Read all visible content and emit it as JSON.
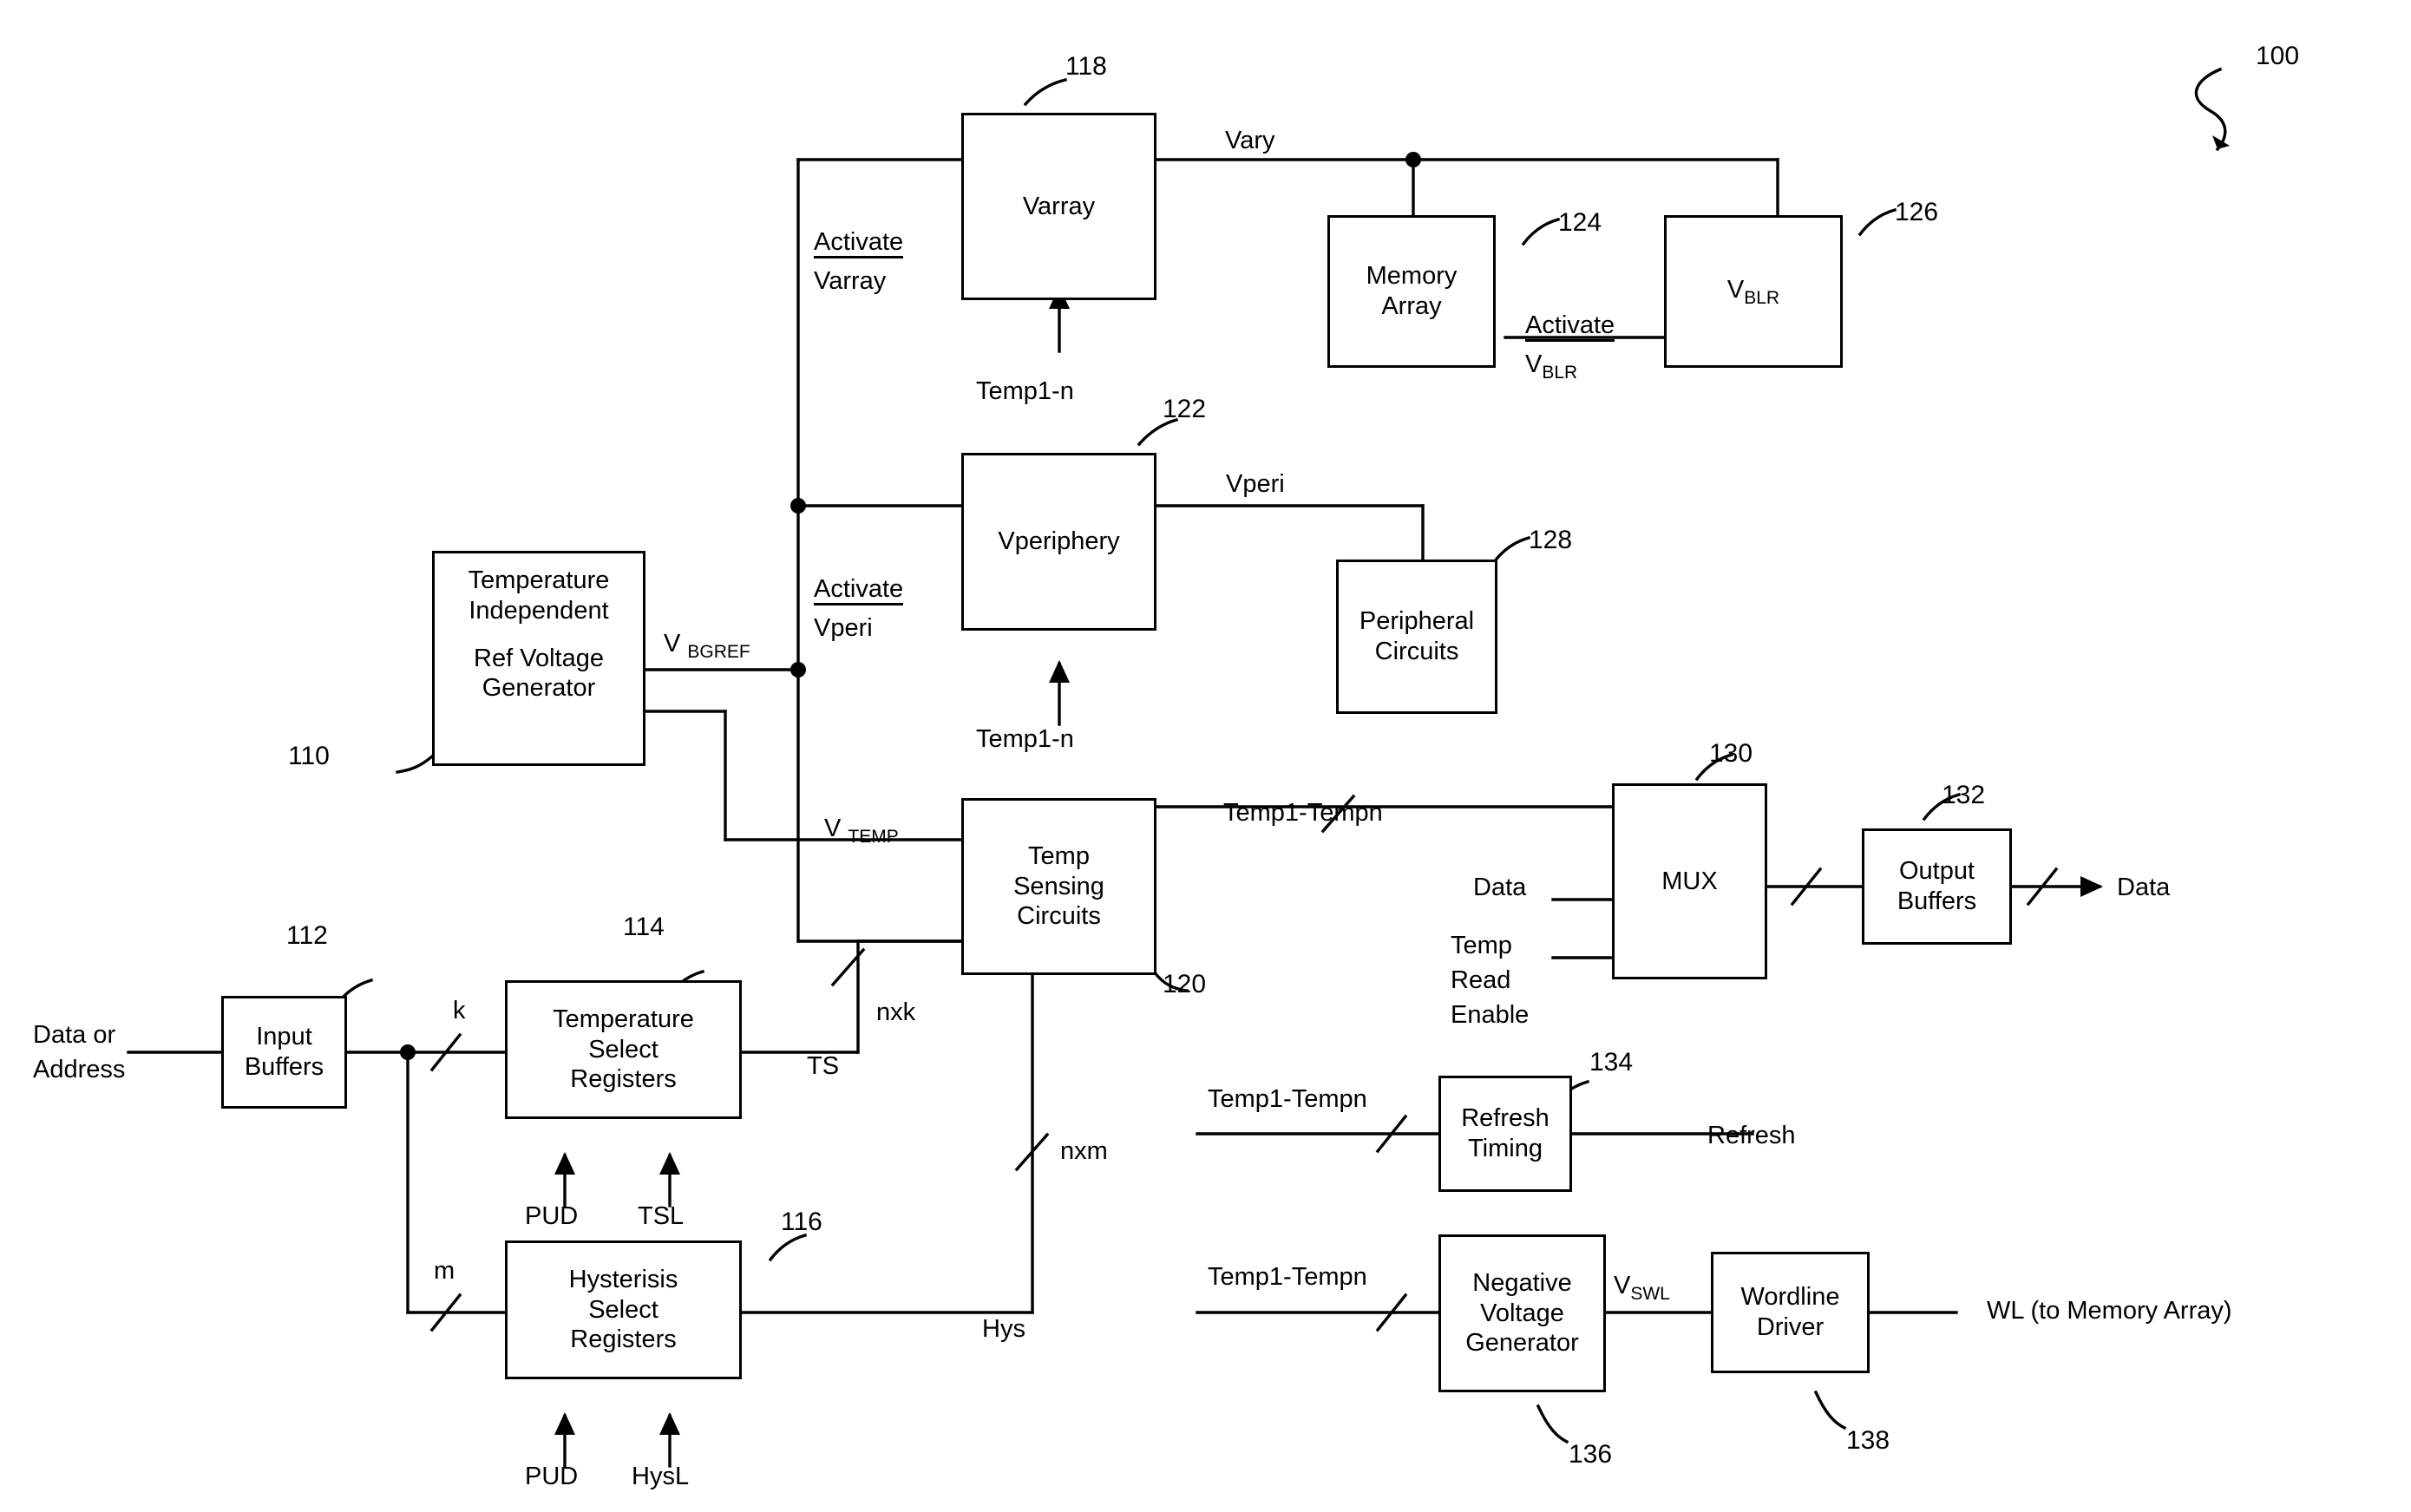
{
  "figure": {
    "number": "100",
    "title": "Memory device temperature-compensated voltage generation block diagram"
  },
  "blocks": [
    {
      "id": "varray",
      "label": "Varray",
      "ref": "118"
    },
    {
      "id": "memory_array",
      "label": "Memory\nArray",
      "ref": "124"
    },
    {
      "id": "vblr",
      "label": "V BLR",
      "ref": "126"
    },
    {
      "id": "vperiphery",
      "label": "Vperiphery",
      "ref": "122"
    },
    {
      "id": "peripheral_circuits",
      "label": "Peripheral\nCircuits",
      "ref": "128"
    },
    {
      "id": "ref_voltage_generator",
      "label": "Temperature\nIndependent\n\nRef Voltage\nGenerator",
      "ref": "110"
    },
    {
      "id": "temp_sensing_circuits",
      "label": "Temp\nSensing\nCircuits",
      "ref": "120"
    },
    {
      "id": "mux",
      "label": "MUX",
      "ref": "130"
    },
    {
      "id": "output_buffers",
      "label": "Output\nBuffers",
      "ref": "132"
    },
    {
      "id": "input_buffers",
      "label": "Input\nBuffers",
      "ref": "112"
    },
    {
      "id": "temperature_select_registers",
      "label": "Temperature\nSelect\nRegisters",
      "ref": "114"
    },
    {
      "id": "hysterisis_select_registers",
      "label": "Hysterisis\nSelect\nRegisters",
      "ref": "116"
    },
    {
      "id": "refresh_timing",
      "label": "Refresh\nTiming",
      "ref": "134"
    },
    {
      "id": "negative_voltage_generator",
      "label": "Negative\nVoltage\nGenerator",
      "ref": "136"
    },
    {
      "id": "wordline_driver",
      "label": "Wordline\nDriver",
      "ref": "138"
    }
  ],
  "block_text": {
    "varray": "Varray",
    "memory_array_l1": "Memory",
    "memory_array_l2": "Array",
    "vblr_v": "V",
    "vblr_sub": "BLR",
    "vperiphery": "Vperiphery",
    "peripheral_l1": "Peripheral",
    "peripheral_l2": "Circuits",
    "refgen_l1": "Temperature",
    "refgen_l2": "Independent",
    "refgen_l3": "Ref Voltage",
    "refgen_l4": "Generator",
    "temp_l1": "Temp",
    "temp_l2": "Sensing",
    "temp_l3": "Circuits",
    "mux": "MUX",
    "outbuf_l1": "Output",
    "outbuf_l2": "Buffers",
    "inbuf_l1": "Input",
    "inbuf_l2": "Buffers",
    "tsr_l1": "Temperature",
    "tsr_l2": "Select",
    "tsr_l3": "Registers",
    "hsr_l1": "Hysterisis",
    "hsr_l2": "Select",
    "hsr_l3": "Registers",
    "refresh_l1": "Refresh",
    "refresh_l2": "Timing",
    "nvg_l1": "Negative",
    "nvg_l2": "Voltage",
    "nvg_l3": "Generator",
    "wld_l1": "Wordline",
    "wld_l2": "Driver"
  },
  "signals": {
    "vary": "Vary",
    "activate_varray_l1": "Activate",
    "activate_varray_l2": "Varray",
    "activate_vblr_l1": "Activate",
    "activate_vblr_v": "V",
    "activate_vblr_sub": "BLR",
    "temp1n_top": "Temp1-n",
    "temp1n_mid": "Temp1-n",
    "vperi": "Vperi",
    "activate_vperi_l1": "Activate",
    "activate_vperi_l2": "Vperi",
    "vbgref_v": "V",
    "vbgref_sub": "BGREF",
    "vtemp_v": "V",
    "vtemp_sub": "TEMP",
    "temp1_tempn_mux": "Temp1-Tempn",
    "temp1_tempn_refresh": "Temp1-Tempn",
    "temp1_tempn_nvg": "Temp1-Tempn",
    "data_in_mux": "Data",
    "temp_read_enable_l1": "Temp",
    "temp_read_enable_l2": "Read",
    "temp_read_enable_l3": "Enable",
    "data_out": "Data",
    "refresh_out": "Refresh",
    "vswl_v": "V",
    "vswl_sub": "SWL",
    "wl_out": "WL (to Memory Array)",
    "data_or_address_l1": "Data or",
    "data_or_address_l2": "Address",
    "bus_k": "k",
    "bus_m": "m",
    "bus_nxk": "nxk",
    "bus_nxm": "nxm",
    "ts": "TS",
    "hys": "Hys",
    "pud_1": "PUD",
    "tsl": "TSL",
    "pud_2": "PUD",
    "hysl": "HysL"
  },
  "reference_numbers": {
    "fig": "100",
    "n110": "110",
    "n112": "112",
    "n114": "114",
    "n116": "116",
    "n118": "118",
    "n120": "120",
    "n122": "122",
    "n124": "124",
    "n126": "126",
    "n128": "128",
    "n130": "130",
    "n132": "132",
    "n134": "134",
    "n136": "136",
    "n138": "138"
  }
}
